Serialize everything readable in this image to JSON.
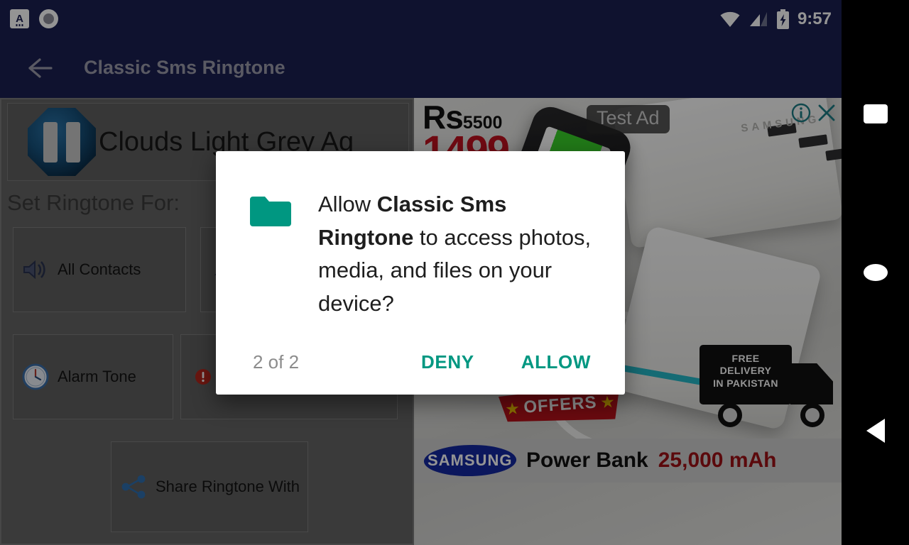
{
  "status_bar": {
    "time": "9:57",
    "icons": [
      "app-a-icon",
      "record-circle-icon",
      "wifi-icon",
      "cellular-signal-icon",
      "battery-charging-icon"
    ]
  },
  "app_bar": {
    "back_icon": "back-arrow-icon",
    "title": "Classic Sms Ringtone"
  },
  "main": {
    "now_playing": {
      "play_pause_icon": "pause-icon",
      "track_title": "Clouds Light Grey Ag"
    },
    "section_label": "Set Ringtone For:",
    "buttons": [
      {
        "label": "All Contacts",
        "icon": "speaker-icon"
      },
      {
        "label": "",
        "icon": "ringtone-icon"
      },
      {
        "label": "Alarm Tone",
        "icon": "clock-icon"
      },
      {
        "label": "",
        "icon": "notification-icon"
      },
      {
        "label": "Share Ringtone With",
        "icon": "share-icon"
      }
    ]
  },
  "ad": {
    "badge": "Test Ad",
    "info_icon": "ad-info-icon",
    "close_icon": "ad-close-icon",
    "price_currency": "Rs",
    "price_old": "5500",
    "price_new": "1499",
    "offers_label": "OFFERS",
    "delivery_line1": "FREE",
    "delivery_line2": "DELIVERY",
    "delivery_line3": "IN PAKISTAN",
    "brand": "SAMSUNG",
    "product": "Power Bank",
    "capacity": "25,000 mAh",
    "watermark": "SAMSUNG"
  },
  "dialog": {
    "icon": "folder-icon",
    "message_prefix": "Allow ",
    "message_app": "Classic Sms Ringtone",
    "message_suffix": " to access photos, media, and files on your device?",
    "counter": "2 of 2",
    "deny_label": "DENY",
    "allow_label": "ALLOW",
    "accent_color": "#009781"
  },
  "nav_bar": {
    "recents_icon": "square-recents-icon",
    "home_icon": "circle-home-icon",
    "back_icon": "triangle-back-icon"
  }
}
